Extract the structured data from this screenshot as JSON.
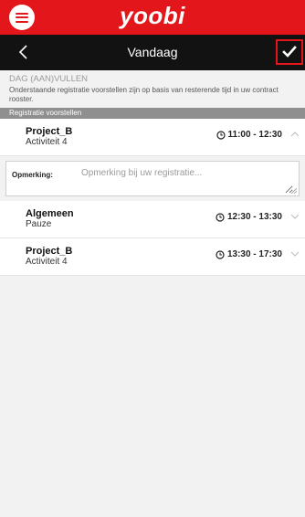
{
  "app": {
    "logo": "yoobi",
    "accent": "#e3171b"
  },
  "nav": {
    "title": "Vandaag"
  },
  "section": {
    "title": "DAG (AAN)VULLEN",
    "description": "Onderstaande registratie voorstellen zijn op basis van resterende tijd in uw contract rooster.",
    "subheader": "Registratie voorstellen"
  },
  "entries": [
    {
      "name": "Project_B",
      "activity": "Activiteit 4",
      "time": "11:00 - 12:30",
      "expanded": true
    },
    {
      "name": "Algemeen",
      "activity": "Pauze",
      "time": "12:30 - 13:30",
      "expanded": false
    },
    {
      "name": "Project_B",
      "activity": "Activiteit 4",
      "time": "13:30 - 17:30",
      "expanded": false
    }
  ],
  "remark": {
    "label": "Opmerking:",
    "placeholder": "Opmerking bij uw registratie..."
  }
}
